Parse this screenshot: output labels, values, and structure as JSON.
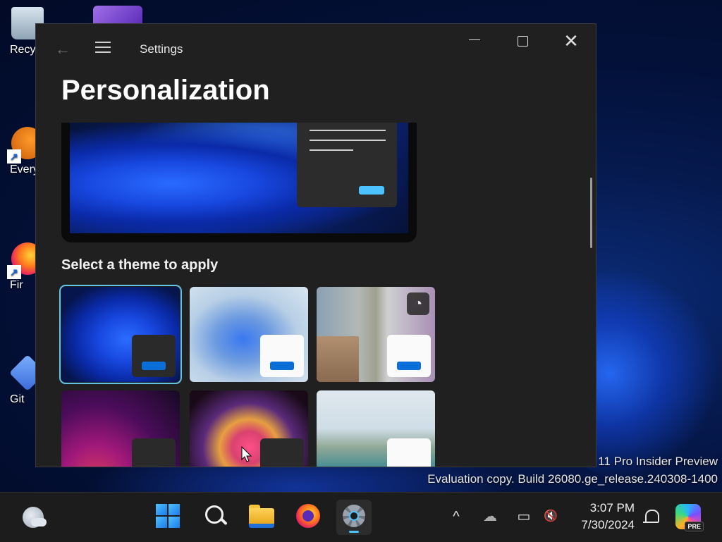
{
  "desktop": {
    "icons": [
      {
        "label": "Recyc"
      },
      {
        "label": "Every"
      },
      {
        "label": "Fir"
      },
      {
        "label": "Git"
      }
    ],
    "watermark": {
      "line1": "11 Pro Insider Preview",
      "line2": "Evaluation copy. Build 26080.ge_release.240308-1400"
    }
  },
  "window": {
    "title": "Settings",
    "page_title": "Personalization",
    "section_label": "Select a theme to apply",
    "themes": [
      {
        "name": "theme-dark-bloom",
        "selected": true
      },
      {
        "name": "theme-light-bloom",
        "selected": false
      },
      {
        "name": "theme-spotlight",
        "selected": false,
        "badge_icon": "slideshow-icon"
      },
      {
        "name": "theme-glow",
        "selected": false
      },
      {
        "name": "theme-captured-motion",
        "selected": false
      },
      {
        "name": "theme-flow",
        "selected": false
      }
    ],
    "colors": {
      "accent": "#4cc2ff",
      "mini_button": "#0a6ed8"
    }
  },
  "taskbar": {
    "apps": [
      "weather-icon",
      "start-icon",
      "search-icon",
      "file-explorer-icon",
      "firefox-icon",
      "settings-icon"
    ],
    "tray": {
      "overflow": "^",
      "onedrive": "☁",
      "network": "▭",
      "volume": "🔇"
    },
    "clock": {
      "time": "3:07 PM",
      "date": "7/30/2024"
    },
    "copilot_badge": "PRE"
  }
}
